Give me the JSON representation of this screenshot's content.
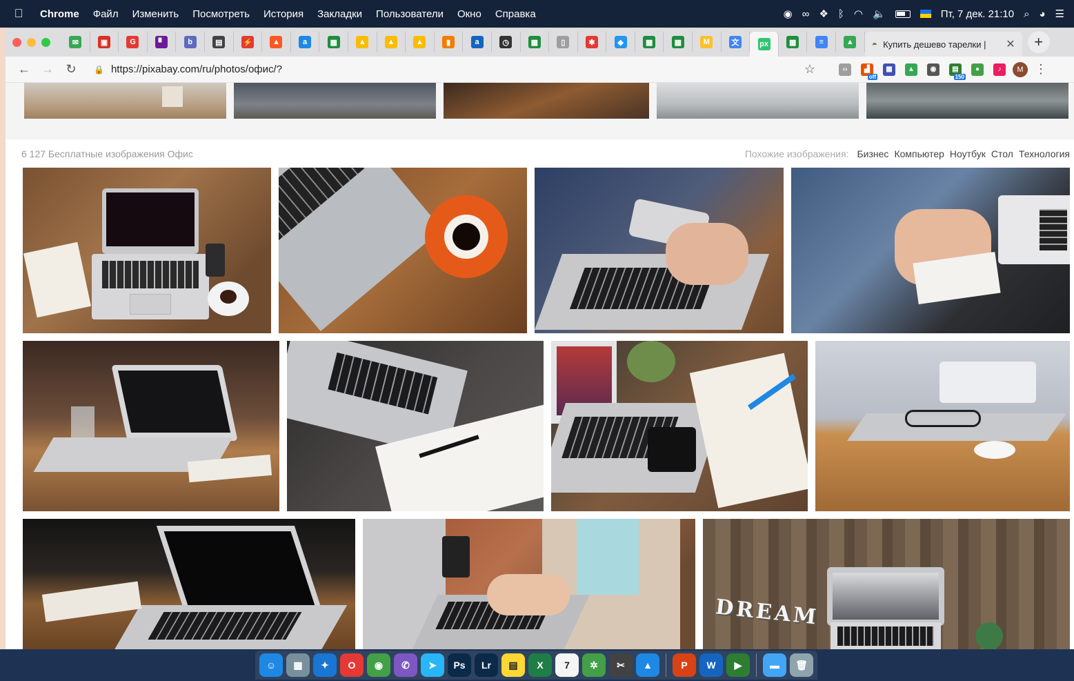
{
  "menubar": {
    "app_name": "Chrome",
    "items": [
      "Файл",
      "Изменить",
      "Посмотреть",
      "История",
      "Закладки",
      "Пользователи",
      "Окно",
      "Справка"
    ],
    "clock": "Пт, 7 дек.  21:10"
  },
  "browser": {
    "pinned_tabs": [
      {
        "icon": "mail-icon",
        "color": "#3aa757",
        "glyph": "✉"
      },
      {
        "icon": "red-square-icon",
        "color": "#d93025",
        "glyph": "▣"
      },
      {
        "icon": "g-icon",
        "color": "#e53935",
        "glyph": "G"
      },
      {
        "icon": "purple-square-icon",
        "color": "#6a1b9a",
        "glyph": "▘"
      },
      {
        "icon": "b-icon",
        "color": "#5c6bc0",
        "glyph": "b"
      },
      {
        "icon": "image-icon",
        "color": "#424242",
        "glyph": "▤"
      },
      {
        "icon": "flash-icon",
        "color": "#e53935",
        "glyph": "⚡"
      },
      {
        "icon": "triangle-red-icon",
        "color": "#ff5722",
        "glyph": "▲"
      },
      {
        "icon": "a-blue-icon",
        "color": "#1e88e5",
        "glyph": "a"
      },
      {
        "icon": "sheets-icon",
        "color": "#1e8e3e",
        "glyph": "▦"
      },
      {
        "icon": "ads-icon",
        "color": "#fbbc04",
        "glyph": "▲"
      },
      {
        "icon": "ads-icon",
        "color": "#fbbc04",
        "glyph": "▲"
      },
      {
        "icon": "ads-icon",
        "color": "#fbbc04",
        "glyph": "▲"
      },
      {
        "icon": "analytics-icon",
        "color": "#f57c00",
        "glyph": "▮"
      },
      {
        "icon": "a-italic-icon",
        "color": "#1565c0",
        "glyph": "a"
      },
      {
        "icon": "clock-icon",
        "color": "#333333",
        "glyph": "◷"
      },
      {
        "icon": "sheets-icon",
        "color": "#1e8e3e",
        "glyph": "▦"
      },
      {
        "icon": "document-icon",
        "color": "#9e9e9e",
        "glyph": "▯"
      },
      {
        "icon": "puzzle-icon",
        "color": "#e53935",
        "glyph": "✱"
      },
      {
        "icon": "drive-icon",
        "color": "#2196f3",
        "glyph": "◆"
      },
      {
        "icon": "sheets-icon",
        "color": "#1e8e3e",
        "glyph": "▦"
      },
      {
        "icon": "sheets-icon",
        "color": "#1e8e3e",
        "glyph": "▦"
      },
      {
        "icon": "m-icon",
        "color": "#fbc02d",
        "glyph": "M"
      },
      {
        "icon": "translate-icon",
        "color": "#4285f4",
        "glyph": "文"
      },
      {
        "icon": "pixabay-icon",
        "color": "#2ec66d",
        "glyph": "px"
      },
      {
        "icon": "sheets-icon",
        "color": "#1e8e3e",
        "glyph": "▦"
      },
      {
        "icon": "docs-icon",
        "color": "#4285f4",
        "glyph": "≡"
      },
      {
        "icon": "google-drive-icon",
        "color": "#34a853",
        "glyph": "▲"
      }
    ],
    "active_pinned_index": 24,
    "active_tab_title": "Купить дешево тарелки |",
    "url": "https://pixabay.com/ru/photos/офис/?",
    "profile_initial": "M",
    "extensions": [
      {
        "icon": "code-icon",
        "color": "#9e9e9e",
        "glyph": "‹›",
        "badge": ""
      },
      {
        "icon": "chart-off-icon",
        "color": "#e65100",
        "glyph": "▟",
        "badge": "off"
      },
      {
        "icon": "grid-icon",
        "color": "#3f51b5",
        "glyph": "▦",
        "badge": ""
      },
      {
        "icon": "google-drive-ext-icon",
        "color": "#34a853",
        "glyph": "▲",
        "badge": ""
      },
      {
        "icon": "bulb-icon",
        "color": "#555555",
        "glyph": "◉",
        "badge": ""
      },
      {
        "icon": "counter-icon",
        "color": "#2e7d32",
        "glyph": "▤",
        "badge": "150"
      },
      {
        "icon": "circle-green-icon",
        "color": "#43a047",
        "glyph": "●",
        "badge": ""
      },
      {
        "icon": "note-icon",
        "color": "#e91e63",
        "glyph": "♪",
        "badge": ""
      }
    ]
  },
  "results": {
    "count_text": "6 127 Бесплатные изображения Офис",
    "related_label": "Похожие изображения:",
    "related_tags": [
      "Бизнес",
      "Компьютер",
      "Ноутбук",
      "Стол",
      "Технология"
    ]
  },
  "photos": {
    "top_strip": [
      "photo-office-interior-1",
      "photo-office-interior-2",
      "photo-office-interior-3",
      "photo-office-interior-4",
      "photo-office-interior-5"
    ],
    "row1": [
      "photo-laptop-notebook-coffee",
      "photo-laptop-orange-coffee",
      "photo-hands-smartphone-laptop",
      "photo-man-writing-notes"
    ],
    "row2": [
      "photo-laptop-table-glass",
      "photo-laptop-notebook-pen",
      "photo-laptop-tablet-writing",
      "photo-laptop-glasses-mouse"
    ],
    "row3": [
      "photo-laptop-notebook-dark",
      "photo-woman-typing-laptop",
      "photo-dream-laptop-desk"
    ]
  },
  "photo_text": {
    "dream": "DREAM"
  },
  "dock": {
    "apps": [
      {
        "icon": "finder-icon",
        "color": "#1e88e5",
        "glyph": "☺"
      },
      {
        "icon": "launchpad-icon",
        "color": "#78909c",
        "glyph": "▦"
      },
      {
        "icon": "safari-icon",
        "color": "#1976d2",
        "glyph": "✦"
      },
      {
        "icon": "opera-icon",
        "color": "#e53935",
        "glyph": "O"
      },
      {
        "icon": "chrome-icon",
        "color": "#43a047",
        "glyph": "◉"
      },
      {
        "icon": "viber-icon",
        "color": "#7e57c2",
        "glyph": "✆"
      },
      {
        "icon": "telegram-icon",
        "color": "#29b6f6",
        "glyph": "➤"
      },
      {
        "icon": "photoshop-icon",
        "color": "#0b2a4a",
        "glyph": "Ps"
      },
      {
        "icon": "lightroom-icon",
        "color": "#0b2a4a",
        "glyph": "Lr"
      },
      {
        "icon": "notes-icon",
        "color": "#fdd835",
        "glyph": "▤"
      },
      {
        "icon": "excel-icon",
        "color": "#1e7e45",
        "glyph": "X"
      },
      {
        "icon": "calendar-icon",
        "color": "#f5f5f5",
        "glyph": "7"
      },
      {
        "icon": "mindnode-icon",
        "color": "#43a047",
        "glyph": "✲"
      },
      {
        "icon": "final-cut-icon",
        "color": "#424242",
        "glyph": "✂"
      },
      {
        "icon": "adwords-editor-icon",
        "color": "#1e88e5",
        "glyph": "▲"
      },
      {
        "icon": "powerpoint-icon",
        "color": "#d84315",
        "glyph": "P"
      },
      {
        "icon": "word-icon",
        "color": "#1565c0",
        "glyph": "W"
      },
      {
        "icon": "facetime-icon",
        "color": "#2e7d32",
        "glyph": "▶"
      },
      {
        "icon": "downloads-folder-icon",
        "color": "#42a5f5",
        "glyph": "▬"
      },
      {
        "icon": "trash-icon",
        "color": "#90a4ae",
        "glyph": "🗑"
      }
    ]
  },
  "colors": {
    "menubar_bg": "#15233a",
    "dock_bg": "#1e3353",
    "page_bg": "#ffffff",
    "muted_text": "#999999"
  }
}
